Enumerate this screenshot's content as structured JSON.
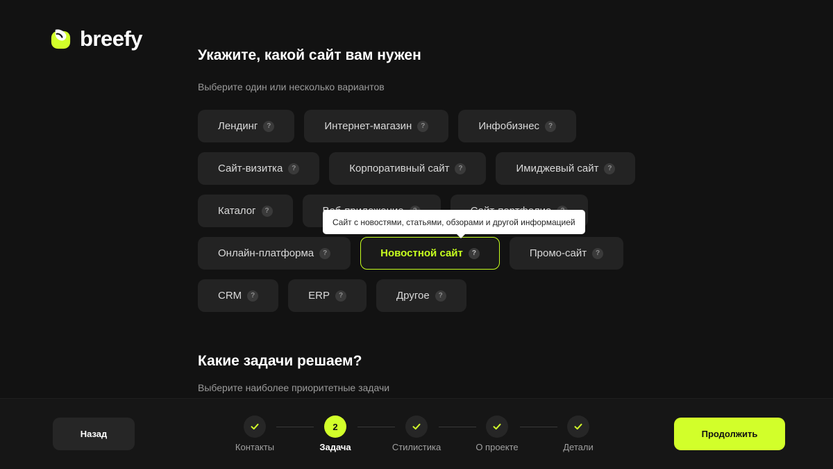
{
  "brand": {
    "name": "breefy",
    "accent": "#d2ff2a"
  },
  "section1": {
    "title": "Укажите, какой сайт вам нужен",
    "subtitle": "Выберите один или несколько вариантов",
    "rows": [
      [
        {
          "label": "Лендинг"
        },
        {
          "label": "Интернет-магазин"
        },
        {
          "label": "Инфобизнес"
        }
      ],
      [
        {
          "label": "Сайт-визитка"
        },
        {
          "label": "Корпоративный сайт"
        },
        {
          "label": "Имиджевый сайт"
        }
      ],
      [
        {
          "label": "Каталог"
        },
        {
          "label": "Веб-приложение"
        },
        {
          "label": "Сайт-портфолио"
        }
      ],
      [
        {
          "label": "Онлайн-платформа"
        },
        {
          "label": "Новостной сайт",
          "selected": true
        },
        {
          "label": "Промо-сайт"
        }
      ],
      [
        {
          "label": "CRM"
        },
        {
          "label": "ERP"
        },
        {
          "label": "Другое"
        }
      ]
    ],
    "help_glyph": "?",
    "tooltip": "Сайт с новостями, статьями, обзорами и другой информацией"
  },
  "section2": {
    "title": "Какие задачи решаем?",
    "subtitle": "Выберите наиболее приоритетные задачи"
  },
  "footer": {
    "back_label": "Назад",
    "next_label": "Продолжить",
    "steps": [
      {
        "label": "Контакты",
        "state": "done"
      },
      {
        "label": "Задача",
        "state": "active",
        "number": "2"
      },
      {
        "label": "Стилистика",
        "state": "done"
      },
      {
        "label": "О проекте",
        "state": "done"
      },
      {
        "label": "Детали",
        "state": "done"
      }
    ]
  }
}
